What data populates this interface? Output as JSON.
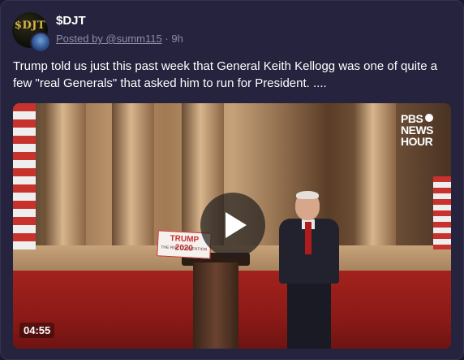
{
  "post": {
    "author": "$DJT",
    "avatar_text": "$DJT",
    "posted_by": "Posted by @summ115",
    "separator": "·",
    "age": "9h",
    "text": "Trump told us just this past week that General Keith Kellogg was one of quite a few \"real Generals\" that asked him to run for President. ...."
  },
  "video": {
    "duration": "04:55",
    "watermark_line1": "PBS",
    "watermark_line2": "NEWS",
    "watermark_line3": "HOUR",
    "sign_main": "TRUMP 2020",
    "sign_sub": "THE RNC CONVENTION"
  },
  "colors": {
    "background": "#25233d",
    "text": "#ffffff",
    "muted": "#8f8ca8"
  }
}
